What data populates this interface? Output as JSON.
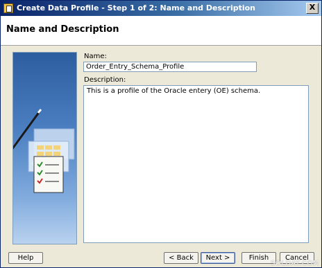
{
  "window": {
    "title": "Create Data Profile - Step 1 of 2: Name and Description",
    "close_label": "X"
  },
  "header": {
    "title": "Name and Description"
  },
  "form": {
    "name_label": "Name:",
    "name_value": "Order_Entry_Schema_Profile",
    "description_label": "Description:",
    "description_value": "This is a profile of the Oracle entery (OE) schema."
  },
  "buttons": {
    "help": "Help",
    "back": "< Back",
    "next": "Next >",
    "finish": "Finish",
    "cancel": "Cancel"
  },
  "watermark": "SOLDAT.COM",
  "colors": {
    "title_bar": "#0a246a",
    "panel": "#ece9d8",
    "art_blue": "#2c5d9f"
  }
}
